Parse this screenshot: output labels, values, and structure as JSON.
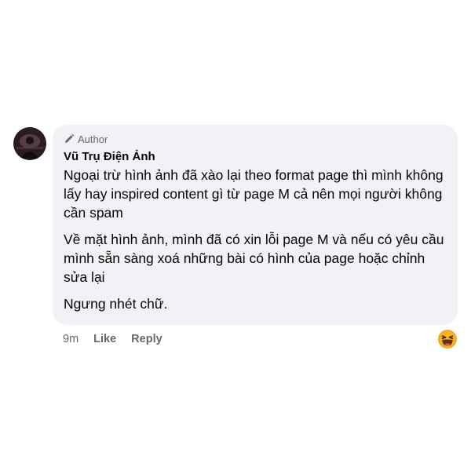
{
  "comment": {
    "badge_label": "Author",
    "badge_icon": "pencil-icon",
    "author_name": "Vũ Trụ Điện Ảnh",
    "paragraphs": [
      "Ngoại trừ hình ảnh đã xào lại theo format page thì mình không lấy hay inspired content gì từ page M cả nên mọi người không cần spam",
      "Về mặt hình ảnh, mình đã có xin lỗi page M và nếu có yêu cầu mình sẵn sàng xoá những bài có hình của page hoặc chỉnh sửa lại",
      "Ngưng nhét chữ."
    ],
    "time": "9m",
    "like_label": "Like",
    "reply_label": "Reply",
    "reaction_icon": "haha-emoji-icon"
  },
  "colors": {
    "bubble_bg": "#f0f2f5",
    "text": "#050505",
    "muted": "#65676b",
    "emoji_yellow": "#f7b125"
  }
}
